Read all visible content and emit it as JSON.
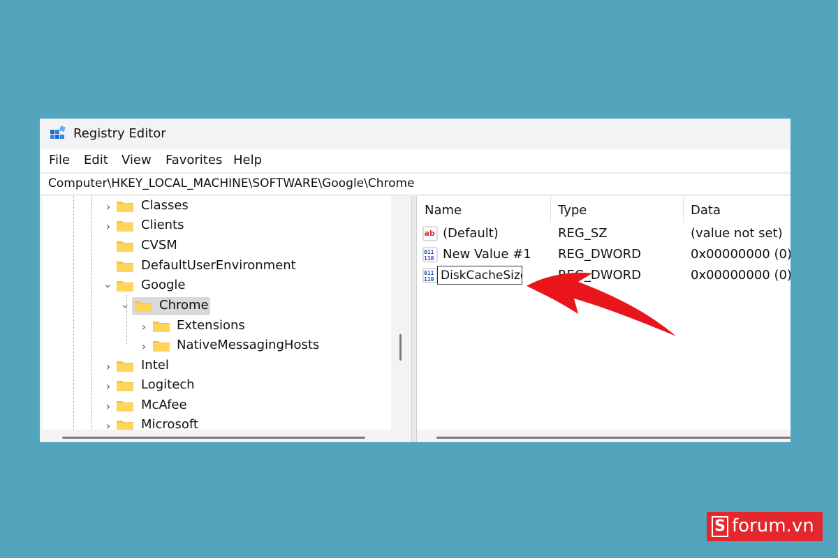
{
  "window": {
    "title": "Registry Editor",
    "icon": "registry-editor-icon"
  },
  "menu": [
    {
      "label": "File"
    },
    {
      "label": "Edit"
    },
    {
      "label": "View"
    },
    {
      "label": "Favorites"
    },
    {
      "label": "Help"
    }
  ],
  "address": {
    "path": "Computer\\HKEY_LOCAL_MACHINE\\SOFTWARE\\Google\\Chrome"
  },
  "tree": {
    "items": [
      {
        "label": "Classes",
        "expander": "collapsed"
      },
      {
        "label": "Clients",
        "expander": "collapsed"
      },
      {
        "label": "CVSM",
        "expander": "none"
      },
      {
        "label": "DefaultUserEnvironment",
        "expander": "none"
      },
      {
        "label": "Google",
        "expander": "expanded"
      },
      {
        "label": "Chrome",
        "expander": "expanded",
        "selected": true
      },
      {
        "label": "Extensions",
        "expander": "collapsed"
      },
      {
        "label": "NativeMessagingHosts",
        "expander": "collapsed"
      },
      {
        "label": "Intel",
        "expander": "collapsed"
      },
      {
        "label": "Logitech",
        "expander": "collapsed"
      },
      {
        "label": "McAfee",
        "expander": "collapsed"
      },
      {
        "label": "Microsoft",
        "expander": "collapsed"
      }
    ]
  },
  "values_list": {
    "columns": [
      "Name",
      "Type",
      "Data"
    ],
    "rows": [
      {
        "icon": "string-value-icon",
        "name": "(Default)",
        "type": "REG_SZ",
        "data": "(value not set)"
      },
      {
        "icon": "binary-value-icon",
        "name": "New Value #1",
        "type": "REG_DWORD",
        "data": "0x00000000 (0)"
      },
      {
        "icon": "binary-value-icon",
        "name": "DiskCacheSize",
        "type": "REG_DWORD",
        "data": "0x00000000 (0)",
        "editing": true
      }
    ]
  },
  "annotation": {
    "arrow_color": "#e8161b"
  },
  "watermark": {
    "mark": "S",
    "text": "forum.vn",
    "color": "#e5272d"
  },
  "colors": {
    "background": "#53a4bd",
    "folder": "#f5c242"
  }
}
